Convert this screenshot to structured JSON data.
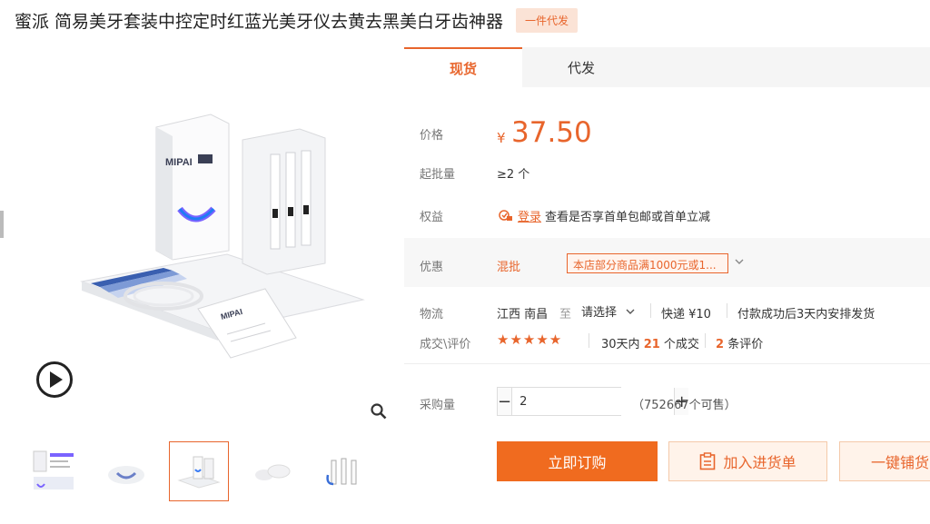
{
  "product": {
    "title": "蜜派 简易美牙套装中控定时红蓝光美牙仪去黄去黑美白牙齿神器",
    "tag": "一件代发"
  },
  "tabs": [
    {
      "label": "现货",
      "active": true
    },
    {
      "label": "代发",
      "active": false
    }
  ],
  "price": {
    "label": "价格",
    "currency": "¥",
    "value": "37.50"
  },
  "moq": {
    "label": "起批量",
    "value": "≥2 个"
  },
  "rights": {
    "label": "权益",
    "login_link": "登录",
    "text": "查看是否享首单包邮或首单立减"
  },
  "promo": {
    "label": "优惠",
    "type": "混批",
    "text": "本店部分商品满1000元或1..."
  },
  "shipping": {
    "label": "物流",
    "from": "江西 南昌",
    "to_word": "至",
    "select": "请选择",
    "fee": "快递 ¥10",
    "time": "付款成功后3天内安排发货"
  },
  "sales": {
    "label": "成交\\评价",
    "stars": "★★★★★",
    "deal_prefix": "30天内",
    "deal_count": "21",
    "deal_suffix": "个成交",
    "review_count": "2",
    "review_suffix": "条评价"
  },
  "purchase": {
    "label": "采购量",
    "minus": "−",
    "quantity": "2",
    "plus": "+",
    "stock": "（752667个可售）"
  },
  "buttons": {
    "buy": "立即订购",
    "cart": "加入进货单",
    "distribute": "一键铺货"
  },
  "colors": {
    "accent": "#e8652c",
    "buy_bg": "#f06b1f"
  },
  "gallery": {
    "thumbnail_count": 5,
    "active_thumbnail": 3
  }
}
